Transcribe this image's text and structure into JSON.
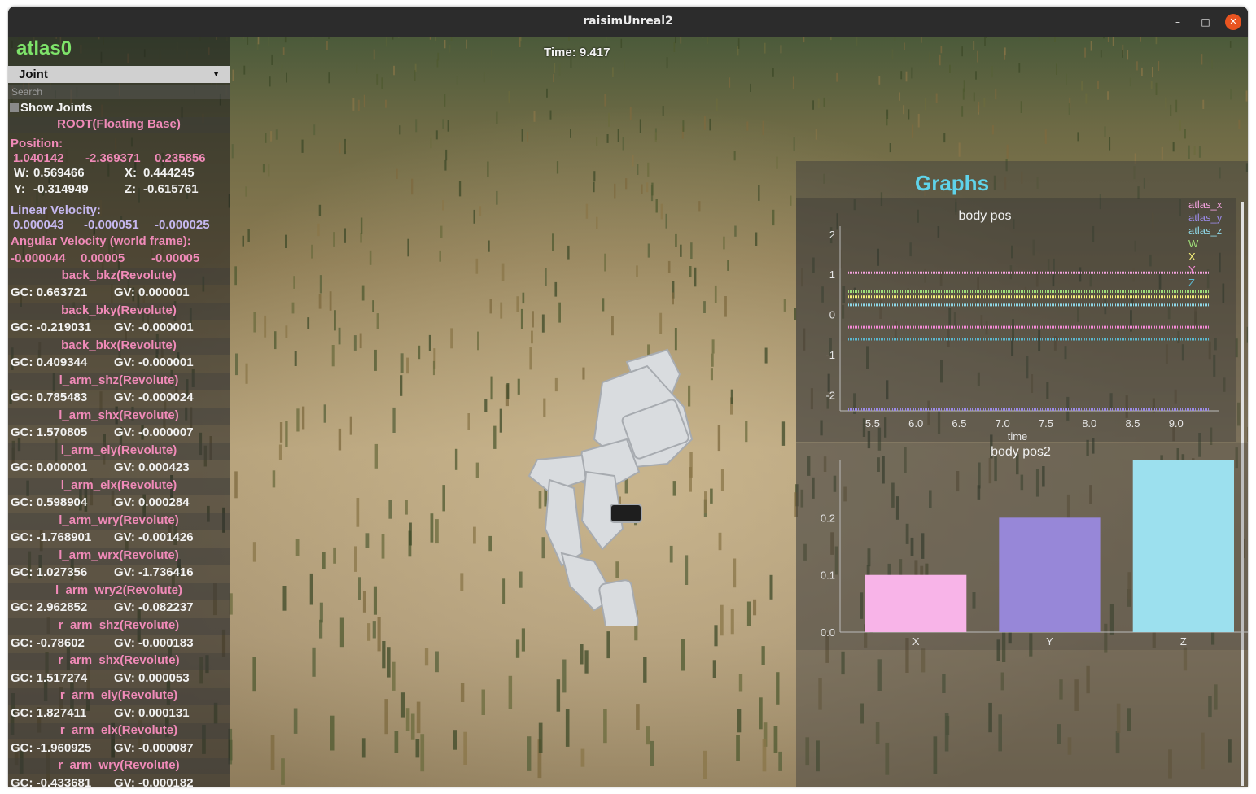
{
  "window": {
    "title": "raisimUnreal2",
    "controls": {
      "minimize_icon": "–",
      "maximize_icon": "□",
      "close_icon": "✕"
    }
  },
  "viewport": {
    "time_label": "Time: 9.417"
  },
  "panel": {
    "title": "atlas0",
    "dropdown_label": "Joint",
    "search_placeholder": "Search",
    "show_joints_label": "Show Joints",
    "root": {
      "header": "ROOT(Floating Base)",
      "position_label": "Position:",
      "position": [
        "1.040142",
        "-2.369371",
        "0.235856"
      ],
      "w_label": "W:",
      "w": "0.569466",
      "x_label": "X:",
      "x": "0.444245",
      "y_label": "Y:",
      "y": "-0.314949",
      "z_label": "Z:",
      "z": "-0.615761",
      "linear_velocity_label": "Linear Velocity:",
      "linear_velocity": [
        "0.000043",
        "-0.000051",
        "-0.000025"
      ],
      "angular_velocity_label": "Angular Velocity (world frame):",
      "angular_velocity": [
        "-0.000044",
        "0.00005",
        "-0.00005"
      ]
    },
    "joints": [
      {
        "name": "back_bkz(Revolute)",
        "gc": "GC: 0.663721",
        "gv": "GV: 0.000001"
      },
      {
        "name": "back_bky(Revolute)",
        "gc": "GC: -0.219031",
        "gv": "GV: -0.000001"
      },
      {
        "name": "back_bkx(Revolute)",
        "gc": "GC: 0.409344",
        "gv": "GV: -0.000001"
      },
      {
        "name": "l_arm_shz(Revolute)",
        "gc": "GC: 0.785483",
        "gv": "GV: -0.000024"
      },
      {
        "name": "l_arm_shx(Revolute)",
        "gc": "GC: 1.570805",
        "gv": "GV: -0.000007"
      },
      {
        "name": "l_arm_ely(Revolute)",
        "gc": "GC: 0.000001",
        "gv": "GV: 0.000423"
      },
      {
        "name": "l_arm_elx(Revolute)",
        "gc": "GC: 0.598904",
        "gv": "GV: 0.000284"
      },
      {
        "name": "l_arm_wry(Revolute)",
        "gc": "GC: -1.768901",
        "gv": "GV: -0.001426"
      },
      {
        "name": "l_arm_wrx(Revolute)",
        "gc": "GC: 1.027356",
        "gv": "GV: -1.736416"
      },
      {
        "name": "l_arm_wry2(Revolute)",
        "gc": "GC: 2.962852",
        "gv": "GV: -0.082237"
      },
      {
        "name": "r_arm_shz(Revolute)",
        "gc": "GC: -0.78602",
        "gv": "GV: -0.000183"
      },
      {
        "name": "r_arm_shx(Revolute)",
        "gc": "GC: 1.517274",
        "gv": "GV: 0.000053"
      },
      {
        "name": "r_arm_ely(Revolute)",
        "gc": "GC: 1.827411",
        "gv": "GV: 0.000131"
      },
      {
        "name": "r_arm_elx(Revolute)",
        "gc": "GC: -1.960925",
        "gv": "GV: -0.000087"
      },
      {
        "name": "r_arm_wry(Revolute)",
        "gc": "GC: -0.433681",
        "gv": "GV: -0.000182"
      }
    ]
  },
  "graphs": {
    "title": "Graphs",
    "colors": {
      "atlas_x": "#f5a3e0",
      "atlas_y": "#9b8ae6",
      "atlas_z": "#8fd8e8",
      "W": "#9fe07a",
      "X": "#f5f07a",
      "Y": "#f58ad8",
      "Z": "#5bb8d0"
    }
  },
  "chart_data": [
    {
      "type": "line",
      "title": "body pos",
      "xlabel": "time",
      "ylabel": "",
      "xlim": [
        5.2,
        9.5
      ],
      "ylim": [
        -2.4,
        2.2
      ],
      "xticks": [
        "5.5",
        "6.0",
        "6.5",
        "7.0",
        "7.5",
        "8.0",
        "8.5",
        "9.0"
      ],
      "yticks": [
        "2",
        "1",
        "0",
        "-1",
        "-2"
      ],
      "legend": [
        "atlas_x",
        "atlas_y",
        "atlas_z",
        "W",
        "X",
        "Y",
        "Z"
      ],
      "legend_position": "top-right",
      "x": [
        5.2,
        9.4
      ],
      "series": [
        {
          "name": "atlas_x",
          "values": [
            1.04,
            1.04
          ]
        },
        {
          "name": "atlas_y",
          "values": [
            -2.37,
            -2.37
          ]
        },
        {
          "name": "atlas_z",
          "values": [
            0.236,
            0.236
          ]
        },
        {
          "name": "W",
          "values": [
            0.569,
            0.569
          ]
        },
        {
          "name": "X",
          "values": [
            0.444,
            0.444
          ]
        },
        {
          "name": "Y",
          "values": [
            -0.315,
            -0.315
          ]
        },
        {
          "name": "Z",
          "values": [
            -0.616,
            -0.616
          ]
        }
      ]
    },
    {
      "type": "bar",
      "title": "body pos2",
      "categories": [
        "X",
        "Y",
        "Z"
      ],
      "values": [
        0.1,
        0.2,
        0.3
      ],
      "colors": [
        "#f8b4e8",
        "#9787d8",
        "#9ce0ee"
      ],
      "ylim": [
        0,
        0.3
      ],
      "yticks": [
        "0.0",
        "0.1",
        "0.2"
      ]
    }
  ]
}
